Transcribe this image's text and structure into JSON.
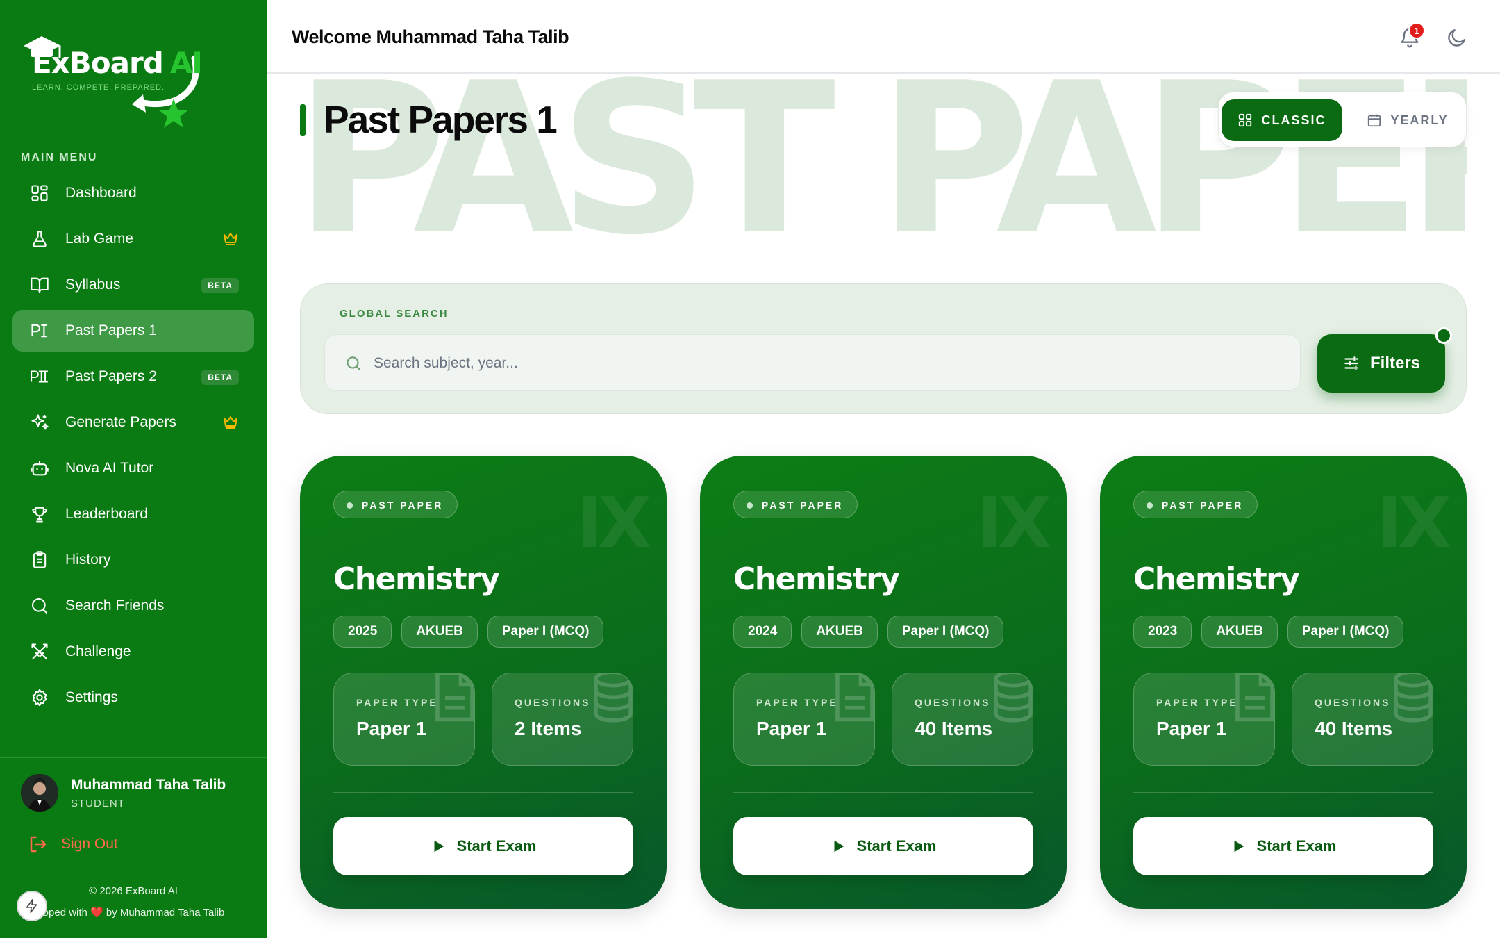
{
  "brand": {
    "name": "ExBoard",
    "name_suffix": "AI",
    "tagline": "LEARN. COMPETE. PREPARED."
  },
  "sidebar": {
    "menu_label": "MAIN MENU",
    "items": [
      {
        "label": "Dashboard",
        "icon": "grid-icon",
        "badge": ""
      },
      {
        "label": "Lab Game",
        "icon": "flask-icon",
        "badge": "",
        "crown": true
      },
      {
        "label": "Syllabus",
        "icon": "book-icon",
        "badge": "BETA"
      },
      {
        "label": "Past Papers 1",
        "icon": "roman-one-icon",
        "badge": "",
        "active": true
      },
      {
        "label": "Past Papers 2",
        "icon": "roman-two-icon",
        "badge": "BETA"
      },
      {
        "label": "Generate Papers",
        "icon": "sparkles-icon",
        "badge": "",
        "crown": true
      },
      {
        "label": "Nova AI Tutor",
        "icon": "bot-icon",
        "badge": ""
      },
      {
        "label": "Leaderboard",
        "icon": "trophy-icon",
        "badge": ""
      },
      {
        "label": "History",
        "icon": "clipboard-icon",
        "badge": ""
      },
      {
        "label": "Search Friends",
        "icon": "search-icon",
        "badge": ""
      },
      {
        "label": "Challenge",
        "icon": "swords-icon",
        "badge": ""
      },
      {
        "label": "Settings",
        "icon": "gear-icon",
        "badge": ""
      }
    ],
    "user": {
      "name": "Muhammad Taha Talib",
      "role": "STUDENT"
    },
    "signout_label": "Sign Out",
    "copyright": "© 2026 ExBoard AI",
    "credit_prefix": "eloped with",
    "credit_suffix": "by Muhammad Taha Talib"
  },
  "header": {
    "welcome": "Welcome Muhammad Taha Talib",
    "notification_count": "1"
  },
  "page": {
    "watermark": "PAST PAPERS",
    "title": "Past Papers 1",
    "view_toggle": {
      "classic": "CLASSIC",
      "yearly": "YEARLY"
    },
    "search": {
      "label": "GLOBAL SEARCH",
      "placeholder": "Search subject, year...",
      "filters_label": "Filters"
    }
  },
  "cards": [
    {
      "tag": "PAST PAPER",
      "grade": "IX",
      "subject": "Chemistry",
      "year": "2025",
      "board": "AKUEB",
      "paper": "Paper I (MCQ)",
      "type_label": "PAPER TYPE",
      "type_value": "Paper 1",
      "questions_label": "QUESTIONS",
      "questions_value": "2 Items",
      "cta": "Start Exam"
    },
    {
      "tag": "PAST PAPER",
      "grade": "IX",
      "subject": "Chemistry",
      "year": "2024",
      "board": "AKUEB",
      "paper": "Paper I (MCQ)",
      "type_label": "PAPER TYPE",
      "type_value": "Paper 1",
      "questions_label": "QUESTIONS",
      "questions_value": "40 Items",
      "cta": "Start Exam"
    },
    {
      "tag": "PAST PAPER",
      "grade": "IX",
      "subject": "Chemistry",
      "year": "2023",
      "board": "AKUEB",
      "paper": "Paper I (MCQ)",
      "type_label": "PAPER TYPE",
      "type_value": "Paper 1",
      "questions_label": "QUESTIONS",
      "questions_value": "40 Items",
      "cta": "Start Exam"
    }
  ],
  "colors": {
    "brand_green": "#0a7a12",
    "active_item": "#3f9a46",
    "accent_light": "#26c42e",
    "danger": "#ff6a4d",
    "badge_red": "#e21b1b"
  }
}
